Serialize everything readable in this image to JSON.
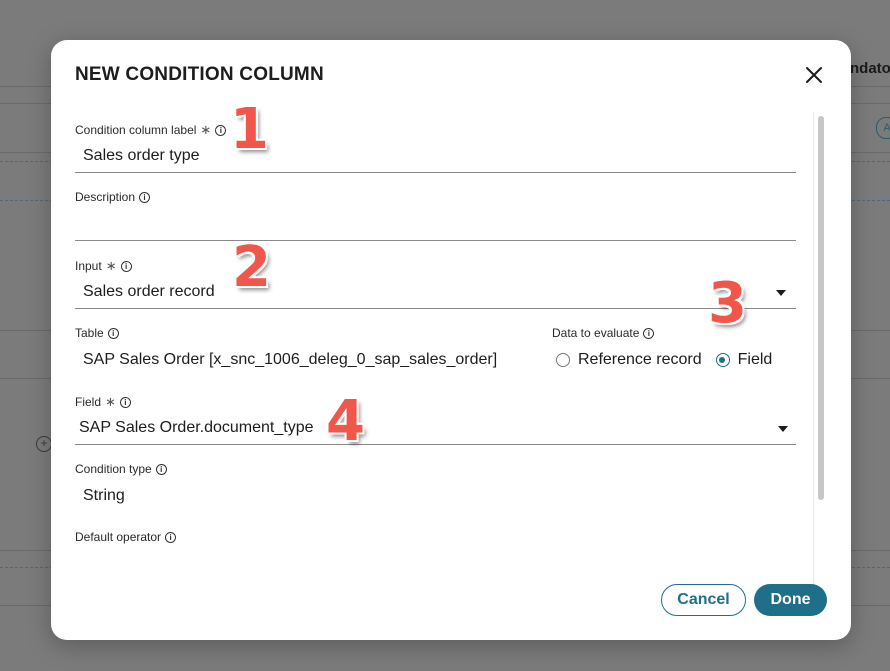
{
  "background": {
    "column_header": "ndatory",
    "badge_text": "A",
    "add_icon": "plus-circle-icon"
  },
  "modal": {
    "title": "NEW CONDITION COLUMN",
    "close_icon": "close-icon",
    "fields": {
      "label": {
        "label": "Condition column label",
        "required": true,
        "value": "Sales order type"
      },
      "description": {
        "label": "Description",
        "value": ""
      },
      "input": {
        "label": "Input",
        "required": true,
        "value": "Sales order record"
      },
      "table": {
        "label": "Table",
        "value": "SAP Sales Order [x_snc_1006_deleg_0_sap_sales_order]"
      },
      "data_to_evaluate": {
        "label": "Data to evaluate",
        "options": [
          "Reference record",
          "Field"
        ],
        "selected": "Field"
      },
      "field": {
        "label": "Field",
        "required": true,
        "value": "SAP Sales Order.document_type"
      },
      "condition_type": {
        "label": "Condition type",
        "value": "String"
      },
      "default_operator": {
        "label": "Default operator",
        "value": ""
      }
    },
    "buttons": {
      "cancel": "Cancel",
      "done": "Done"
    }
  },
  "annotations": [
    "1",
    "2",
    "3",
    "4"
  ],
  "colors": {
    "accent": "#1f6f8a",
    "annotation": "#f0564a",
    "overlay": "#7b7b7b"
  }
}
